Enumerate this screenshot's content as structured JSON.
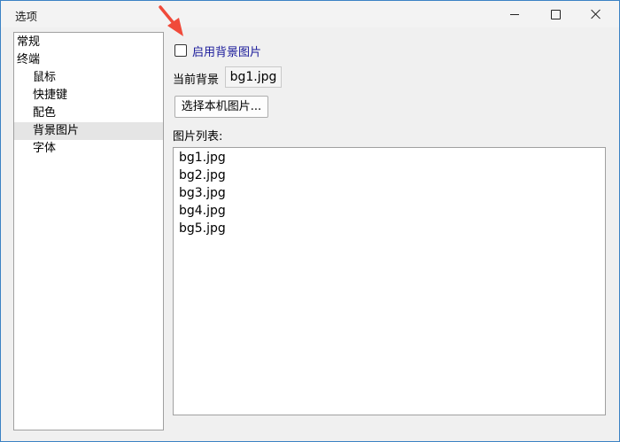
{
  "window": {
    "title": "选项"
  },
  "sidebar": {
    "items": [
      {
        "label": "常规",
        "level": 0,
        "selected": false
      },
      {
        "label": "终端",
        "level": 0,
        "selected": false
      },
      {
        "label": "鼠标",
        "level": 1,
        "selected": false
      },
      {
        "label": "快捷键",
        "level": 1,
        "selected": false
      },
      {
        "label": "配色",
        "level": 1,
        "selected": false
      },
      {
        "label": "背景图片",
        "level": 1,
        "selected": true
      },
      {
        "label": "字体",
        "level": 1,
        "selected": false
      }
    ]
  },
  "background": {
    "enable_label": "启用背景图片",
    "enabled": false,
    "current_label": "当前背景",
    "current_value": "bg1.jpg",
    "select_button_label": "选择本机图片...",
    "list_label": "图片列表:",
    "list_items": [
      "bg1.jpg",
      "bg2.jpg",
      "bg3.jpg",
      "bg4.jpg",
      "bg5.jpg"
    ]
  },
  "colors": {
    "annotation_arrow": "#f04a3a",
    "checkbox_label": "#1a1a9a",
    "selection": "#e5e5e5"
  }
}
